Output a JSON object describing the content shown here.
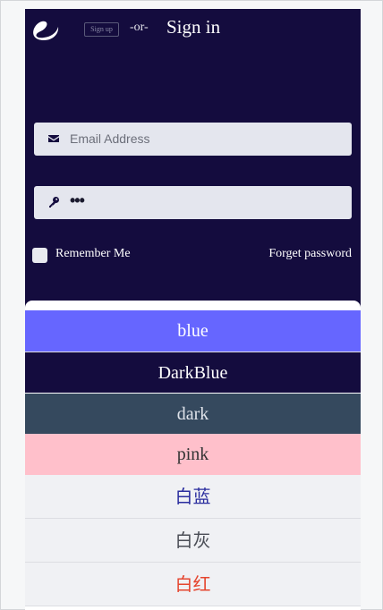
{
  "header": {
    "signup_label": "Sign up",
    "or_label": "-or-",
    "signin_label": "Sign in"
  },
  "form": {
    "email": {
      "placeholder": "Email Address",
      "icon": "envelope-icon"
    },
    "password": {
      "value_masked": "•••",
      "icon": "key-icon"
    },
    "remember_label": "Remember Me",
    "remember_checked": false,
    "forget_label": "Forget password"
  },
  "themes": {
    "blue": "blue",
    "darkblue": "DarkBlue",
    "dark": "dark",
    "pink": "pink",
    "whiteblue": "白蓝",
    "whitegray": "白灰",
    "whitered": "白红"
  },
  "colors": {
    "app_bg": "#140c3e",
    "blue": "#6666ff",
    "dark": "#35495e",
    "pink": "#ffc0cb",
    "field_bg": "#e4e6ee"
  }
}
